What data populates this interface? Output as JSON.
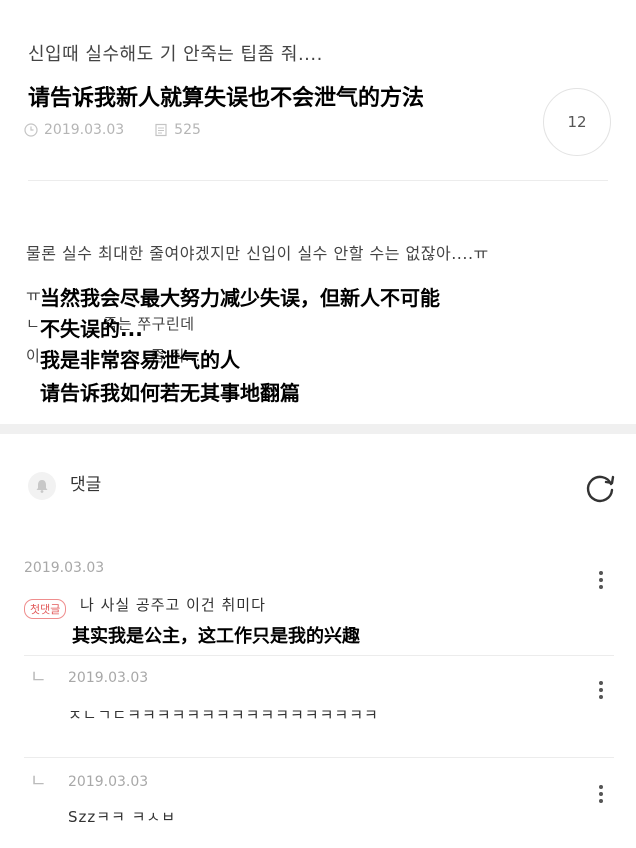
{
  "post": {
    "title_kr": "신입때 실수해도 기 안죽는 팁좀 줘....",
    "title_cn_caption": "请告诉我新人就算失误也不会泄气的方法",
    "date": "2019.03.03",
    "views": "525",
    "comment_count": "12",
    "body_kr_line1": "물론 실수 최대한 줄여야겠지만 신입이 실수 안할 수는 없잖아....ㅠ",
    "body_kr_line2_prefix": "ㅠ",
    "body_kr_line3_partial": "ㄴ            죽는 쭈구린데",
    "body_kr_line4_partial": "이                     좀 줘...",
    "body_cn_caption": [
      "当然我会尽最大努力减少失误，但新人不可能",
      "不失误的...",
      "我是非常容易泄气的人",
      "请告诉我如何若无其事地翻篇"
    ]
  },
  "comments_section": {
    "header_label": "댓글",
    "bell_icon": "bell-icon",
    "refresh_icon": "refresh-icon"
  },
  "comments": [
    {
      "date": "2019.03.03",
      "badge": "첫댓글",
      "text": "나 사실 공주고 이건 취미다",
      "cn_caption": "其实我是公主，这工作只是我的兴趣"
    },
    {
      "date": "2019.03.03",
      "reply_mark": "ㄴ",
      "text": "ㅈㄴㄱㄷㅋㅋㅋㅋㅋㅋㅋㅋㅋㅋㅋㅋㅋㅋㅋㅋㅋ"
    },
    {
      "date": "2019.03.03",
      "reply_mark": "ㄴ",
      "text": "Szzㅋㅋ ㅋㅅㅂ"
    }
  ]
}
